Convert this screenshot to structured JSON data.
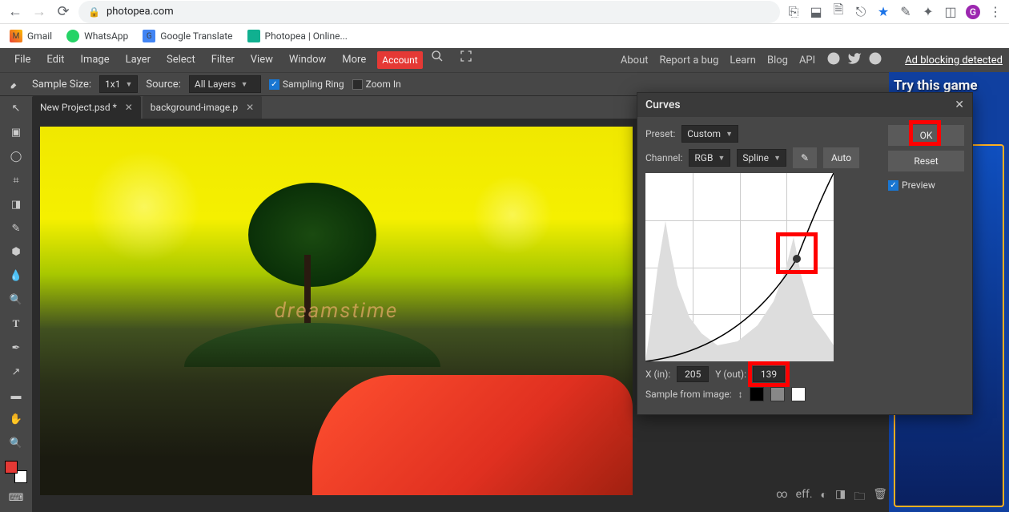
{
  "browser": {
    "url": "photopea.com",
    "profile_initial": "G",
    "bookmarks": [
      {
        "label": "Gmail"
      },
      {
        "label": "WhatsApp"
      },
      {
        "label": "Google Translate"
      },
      {
        "label": "Photopea | Online..."
      }
    ]
  },
  "menu": {
    "items": [
      "File",
      "Edit",
      "Image",
      "Layer",
      "Select",
      "Filter",
      "View",
      "Window",
      "More"
    ],
    "account": "Account",
    "right": [
      "About",
      "Report a bug",
      "Learn",
      "Blog",
      "API"
    ],
    "ad_detect": "Ad blocking detected"
  },
  "options": {
    "sample_size_label": "Sample Size:",
    "sample_size_value": "1x1",
    "source_label": "Source:",
    "source_value": "All Layers",
    "sampling_ring": "Sampling Ring",
    "zoom_in": "Zoom In"
  },
  "tabs": [
    {
      "label": "New Project.psd *",
      "active": true
    },
    {
      "label": "background-image.p",
      "active": false
    }
  ],
  "canvas": {
    "watermark": "dreamstime"
  },
  "ad": {
    "headline": "Try this game"
  },
  "dialog": {
    "title": "Curves",
    "preset_label": "Preset:",
    "preset_value": "Custom",
    "channel_label": "Channel:",
    "channel_value": "RGB",
    "interp_value": "Spline",
    "auto": "Auto",
    "x_label": "X (in):",
    "x_value": "205",
    "y_label": "Y (out):",
    "y_value": "139",
    "sample_label": "Sample from image:",
    "ok": "OK",
    "reset": "Reset",
    "preview": "Preview"
  },
  "bottom_icons": [
    "∞",
    "eff.",
    "◐",
    "◨",
    "🗀",
    "🗑"
  ]
}
